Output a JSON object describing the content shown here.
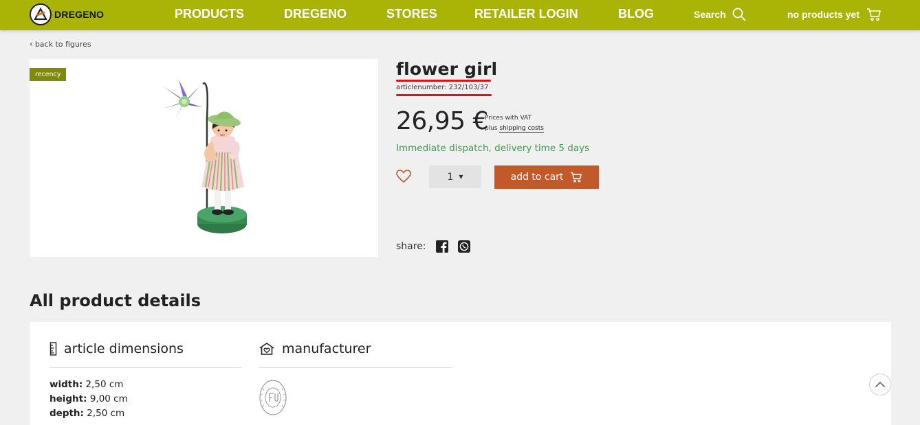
{
  "brand": {
    "name": "DREGENO",
    "color": "#a9b406"
  },
  "nav": [
    {
      "label": "PRODUCTS"
    },
    {
      "label": "DREGENO"
    },
    {
      "label": "STORES"
    },
    {
      "label": "RETAILER LOGIN"
    },
    {
      "label": "BLOG"
    }
  ],
  "search": {
    "label": "Search",
    "icon": "search-icon"
  },
  "cart": {
    "label": "no products yet",
    "icon": "cart-icon"
  },
  "back": {
    "label": "back to figures"
  },
  "image": {
    "badge": "recency"
  },
  "product": {
    "title": "flower girl",
    "article": "articlenumber: 232/103/37",
    "price": "26,95 €",
    "vat_line": "Prices with VAT",
    "shipping_prefix": "plus",
    "shipping_link": "shipping costs",
    "dispatch": "Immediate dispatch, delivery time 5 days",
    "quantity": "1",
    "add_to_cart": "add to cart",
    "share_label": "share:"
  },
  "details": {
    "title": "All product details",
    "dimensions_heading": "article dimensions",
    "manufacturer_heading": "manufacturer",
    "width_label": "width:",
    "width_value": "2,50 cm",
    "height_label": "height:",
    "height_value": "9,00 cm",
    "depth_label": "depth:",
    "depth_value": "2,50 cm"
  },
  "colors": {
    "header": "#a9b406",
    "badge": "#7f8a05",
    "add_to_cart": "#c1592a",
    "dispatch": "#3d9a4a",
    "highlight": "#e0101a"
  }
}
